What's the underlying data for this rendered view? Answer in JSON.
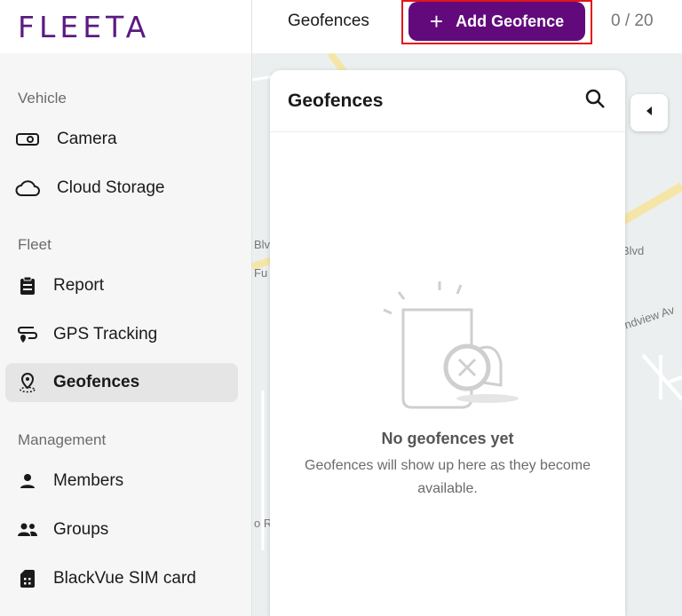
{
  "brand": {
    "logo": "FLEETA",
    "color": "#5b1a82"
  },
  "topbar": {
    "title": "Geofences",
    "add_button": "Add Geofence",
    "counter": "0 / 20",
    "accent": "#620a7c"
  },
  "sidebar": {
    "sections": [
      {
        "label": "Vehicle"
      },
      {
        "label": "Fleet"
      },
      {
        "label": "Management"
      }
    ],
    "items": [
      {
        "label": "Camera",
        "icon": "camera-icon"
      },
      {
        "label": "Cloud Storage",
        "icon": "cloud-icon"
      },
      {
        "label": "Report",
        "icon": "clipboard-icon"
      },
      {
        "label": "GPS Tracking",
        "icon": "gps-tracking-icon"
      },
      {
        "label": "Geofences",
        "icon": "location-pin-icon",
        "active": true
      },
      {
        "label": "Members",
        "icon": "person-icon"
      },
      {
        "label": "Groups",
        "icon": "group-icon"
      },
      {
        "label": "BlackVue SIM card",
        "icon": "sim-card-icon"
      }
    ]
  },
  "panel": {
    "title": "Geofences",
    "empty_title": "No geofences yet",
    "empty_description": "Geofences will show up here as they become available."
  },
  "map": {
    "labels": [
      "Blvd",
      "Blvd",
      "ndview Av",
      "Fu",
      "o R"
    ]
  }
}
